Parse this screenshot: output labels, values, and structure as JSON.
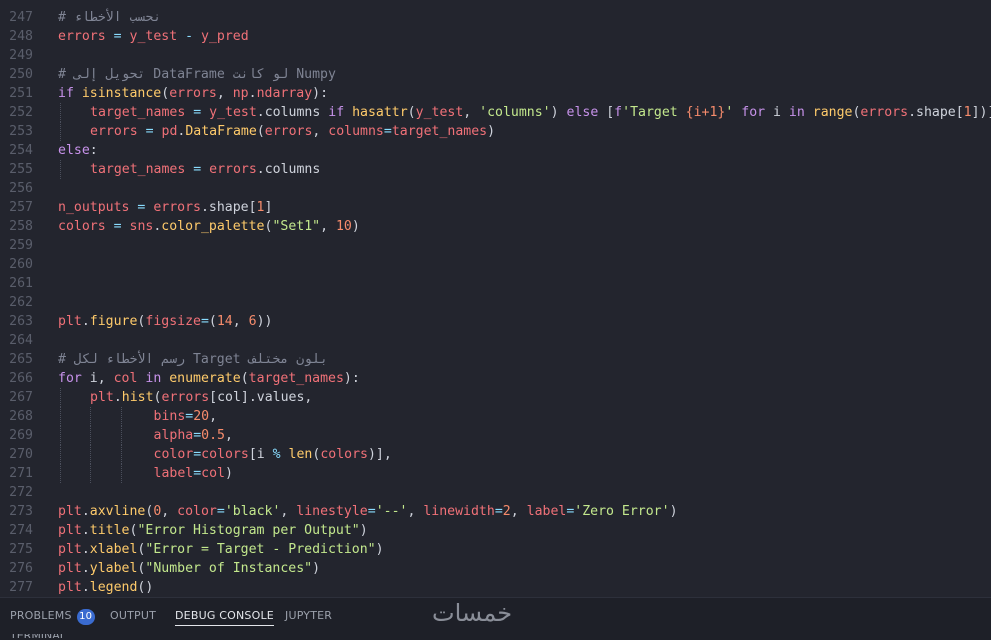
{
  "editor": {
    "lines": [
      {
        "n": "247",
        "indent": [],
        "tokens": [
          {
            "t": "# ",
            "c": "c"
          },
          {
            "t": "نحسب الأخطاء",
            "c": "c"
          }
        ]
      },
      {
        "n": "248",
        "indent": [],
        "tokens": [
          {
            "t": "errors",
            "c": "v"
          },
          {
            "t": " ",
            "c": "p"
          },
          {
            "t": "=",
            "c": "o"
          },
          {
            "t": " ",
            "c": "p"
          },
          {
            "t": "y_test",
            "c": "v"
          },
          {
            "t": " ",
            "c": "p"
          },
          {
            "t": "-",
            "c": "o"
          },
          {
            "t": " ",
            "c": "p"
          },
          {
            "t": "y_pred",
            "c": "v"
          }
        ]
      },
      {
        "n": "249",
        "indent": [],
        "tokens": []
      },
      {
        "n": "250",
        "indent": [],
        "tokens": [
          {
            "t": "# ",
            "c": "c"
          },
          {
            "t": "تحويل إلى DataFrame لو كانت Numpy",
            "c": "c"
          }
        ]
      },
      {
        "n": "251",
        "indent": [],
        "tokens": [
          {
            "t": "if",
            "c": "k"
          },
          {
            "t": " ",
            "c": "p"
          },
          {
            "t": "isinstance",
            "c": "f"
          },
          {
            "t": "(",
            "c": "p"
          },
          {
            "t": "errors",
            "c": "v"
          },
          {
            "t": ", ",
            "c": "p"
          },
          {
            "t": "np",
            "c": "v"
          },
          {
            "t": ".",
            "c": "p"
          },
          {
            "t": "ndarray",
            "c": "v"
          },
          {
            "t": "):",
            "c": "p"
          }
        ]
      },
      {
        "n": "252",
        "indent": [
          1
        ],
        "tokens": [
          {
            "t": "target_names",
            "c": "v"
          },
          {
            "t": " ",
            "c": "p"
          },
          {
            "t": "=",
            "c": "o"
          },
          {
            "t": " ",
            "c": "p"
          },
          {
            "t": "y_test",
            "c": "v"
          },
          {
            "t": ".columns ",
            "c": "p"
          },
          {
            "t": "if",
            "c": "k"
          },
          {
            "t": " ",
            "c": "p"
          },
          {
            "t": "hasattr",
            "c": "f"
          },
          {
            "t": "(",
            "c": "p"
          },
          {
            "t": "y_test",
            "c": "v"
          },
          {
            "t": ", ",
            "c": "p"
          },
          {
            "t": "'columns'",
            "c": "s"
          },
          {
            "t": ") ",
            "c": "p"
          },
          {
            "t": "else",
            "c": "k"
          },
          {
            "t": " [",
            "c": "p"
          },
          {
            "t": "f",
            "c": "k"
          },
          {
            "t": "'Target ",
            "c": "s"
          },
          {
            "t": "{i+1}",
            "c": "n"
          },
          {
            "t": "'",
            "c": "s"
          },
          {
            "t": " ",
            "c": "p"
          },
          {
            "t": "for",
            "c": "k"
          },
          {
            "t": " i ",
            "c": "p"
          },
          {
            "t": "in",
            "c": "k"
          },
          {
            "t": " ",
            "c": "p"
          },
          {
            "t": "range",
            "c": "f"
          },
          {
            "t": "(",
            "c": "p"
          },
          {
            "t": "errors",
            "c": "v"
          },
          {
            "t": ".shape[",
            "c": "p"
          },
          {
            "t": "1",
            "c": "n"
          },
          {
            "t": "])]",
            "c": "p"
          }
        ]
      },
      {
        "n": "253",
        "indent": [
          1
        ],
        "tokens": [
          {
            "t": "errors",
            "c": "v"
          },
          {
            "t": " ",
            "c": "p"
          },
          {
            "t": "=",
            "c": "o"
          },
          {
            "t": " ",
            "c": "p"
          },
          {
            "t": "pd",
            "c": "v"
          },
          {
            "t": ".",
            "c": "p"
          },
          {
            "t": "DataFrame",
            "c": "f"
          },
          {
            "t": "(",
            "c": "p"
          },
          {
            "t": "errors",
            "c": "v"
          },
          {
            "t": ", ",
            "c": "p"
          },
          {
            "t": "columns",
            "c": "v"
          },
          {
            "t": "=",
            "c": "o"
          },
          {
            "t": "target_names",
            "c": "v"
          },
          {
            "t": ")",
            "c": "p"
          }
        ]
      },
      {
        "n": "254",
        "indent": [],
        "tokens": [
          {
            "t": "else",
            "c": "k"
          },
          {
            "t": ":",
            "c": "p"
          }
        ]
      },
      {
        "n": "255",
        "indent": [
          1
        ],
        "tokens": [
          {
            "t": "target_names",
            "c": "v"
          },
          {
            "t": " ",
            "c": "p"
          },
          {
            "t": "=",
            "c": "o"
          },
          {
            "t": " ",
            "c": "p"
          },
          {
            "t": "errors",
            "c": "v"
          },
          {
            "t": ".columns",
            "c": "p"
          }
        ]
      },
      {
        "n": "256",
        "indent": [],
        "tokens": []
      },
      {
        "n": "257",
        "indent": [],
        "tokens": [
          {
            "t": "n_outputs",
            "c": "v"
          },
          {
            "t": " ",
            "c": "p"
          },
          {
            "t": "=",
            "c": "o"
          },
          {
            "t": " ",
            "c": "p"
          },
          {
            "t": "errors",
            "c": "v"
          },
          {
            "t": ".shape[",
            "c": "p"
          },
          {
            "t": "1",
            "c": "n"
          },
          {
            "t": "]",
            "c": "p"
          }
        ]
      },
      {
        "n": "258",
        "indent": [],
        "tokens": [
          {
            "t": "colors",
            "c": "v"
          },
          {
            "t": " ",
            "c": "p"
          },
          {
            "t": "=",
            "c": "o"
          },
          {
            "t": " ",
            "c": "p"
          },
          {
            "t": "sns",
            "c": "v"
          },
          {
            "t": ".",
            "c": "p"
          },
          {
            "t": "color_palette",
            "c": "f"
          },
          {
            "t": "(",
            "c": "p"
          },
          {
            "t": "\"Set1\"",
            "c": "s"
          },
          {
            "t": ", ",
            "c": "p"
          },
          {
            "t": "10",
            "c": "n"
          },
          {
            "t": ")",
            "c": "p"
          }
        ]
      },
      {
        "n": "259",
        "indent": [],
        "tokens": []
      },
      {
        "n": "260",
        "indent": [],
        "tokens": []
      },
      {
        "n": "261",
        "indent": [],
        "tokens": []
      },
      {
        "n": "262",
        "indent": [],
        "tokens": []
      },
      {
        "n": "263",
        "indent": [],
        "tokens": [
          {
            "t": "plt",
            "c": "v"
          },
          {
            "t": ".",
            "c": "p"
          },
          {
            "t": "figure",
            "c": "f"
          },
          {
            "t": "(",
            "c": "p"
          },
          {
            "t": "figsize",
            "c": "v"
          },
          {
            "t": "=",
            "c": "o"
          },
          {
            "t": "(",
            "c": "p"
          },
          {
            "t": "14",
            "c": "n"
          },
          {
            "t": ", ",
            "c": "p"
          },
          {
            "t": "6",
            "c": "n"
          },
          {
            "t": "))",
            "c": "p"
          }
        ]
      },
      {
        "n": "264",
        "indent": [],
        "tokens": []
      },
      {
        "n": "265",
        "indent": [],
        "tokens": [
          {
            "t": "# ",
            "c": "c"
          },
          {
            "t": "رسم الأخطاء لكل Target بلون مختلف",
            "c": "c"
          }
        ]
      },
      {
        "n": "266",
        "indent": [],
        "tokens": [
          {
            "t": "for",
            "c": "k"
          },
          {
            "t": " i, ",
            "c": "p"
          },
          {
            "t": "col",
            "c": "v"
          },
          {
            "t": " ",
            "c": "p"
          },
          {
            "t": "in",
            "c": "k"
          },
          {
            "t": " ",
            "c": "p"
          },
          {
            "t": "enumerate",
            "c": "f"
          },
          {
            "t": "(",
            "c": "p"
          },
          {
            "t": "target_names",
            "c": "v"
          },
          {
            "t": "):",
            "c": "p"
          }
        ]
      },
      {
        "n": "267",
        "indent": [
          1
        ],
        "tokens": [
          {
            "t": "plt",
            "c": "v"
          },
          {
            "t": ".",
            "c": "p"
          },
          {
            "t": "hist",
            "c": "f"
          },
          {
            "t": "(",
            "c": "p"
          },
          {
            "t": "errors",
            "c": "v"
          },
          {
            "t": "[col].values,",
            "c": "p"
          }
        ]
      },
      {
        "n": "268",
        "indent": [
          1,
          2,
          3
        ],
        "tokens": [
          {
            "t": "        bins",
            "c": "v"
          },
          {
            "t": "=",
            "c": "o"
          },
          {
            "t": "20",
            "c": "n"
          },
          {
            "t": ",",
            "c": "p"
          }
        ]
      },
      {
        "n": "269",
        "indent": [
          1,
          2,
          3
        ],
        "tokens": [
          {
            "t": "        alpha",
            "c": "v"
          },
          {
            "t": "=",
            "c": "o"
          },
          {
            "t": "0.5",
            "c": "n"
          },
          {
            "t": ",",
            "c": "p"
          }
        ]
      },
      {
        "n": "270",
        "indent": [
          1,
          2,
          3
        ],
        "tokens": [
          {
            "t": "        color",
            "c": "v"
          },
          {
            "t": "=",
            "c": "o"
          },
          {
            "t": "colors",
            "c": "v"
          },
          {
            "t": "[i ",
            "c": "p"
          },
          {
            "t": "%",
            "c": "o"
          },
          {
            "t": " ",
            "c": "p"
          },
          {
            "t": "len",
            "c": "f"
          },
          {
            "t": "(",
            "c": "p"
          },
          {
            "t": "colors",
            "c": "v"
          },
          {
            "t": ")],",
            "c": "p"
          }
        ]
      },
      {
        "n": "271",
        "indent": [
          1,
          2,
          3
        ],
        "tokens": [
          {
            "t": "        label",
            "c": "v"
          },
          {
            "t": "=",
            "c": "o"
          },
          {
            "t": "col",
            "c": "v"
          },
          {
            "t": ")",
            "c": "p"
          }
        ]
      },
      {
        "n": "272",
        "indent": [],
        "tokens": []
      },
      {
        "n": "273",
        "indent": [],
        "tokens": [
          {
            "t": "plt",
            "c": "v"
          },
          {
            "t": ".",
            "c": "p"
          },
          {
            "t": "axvline",
            "c": "f"
          },
          {
            "t": "(",
            "c": "p"
          },
          {
            "t": "0",
            "c": "n"
          },
          {
            "t": ", ",
            "c": "p"
          },
          {
            "t": "color",
            "c": "v"
          },
          {
            "t": "=",
            "c": "o"
          },
          {
            "t": "'black'",
            "c": "s"
          },
          {
            "t": ", ",
            "c": "p"
          },
          {
            "t": "linestyle",
            "c": "v"
          },
          {
            "t": "=",
            "c": "o"
          },
          {
            "t": "'--'",
            "c": "s"
          },
          {
            "t": ", ",
            "c": "p"
          },
          {
            "t": "linewidth",
            "c": "v"
          },
          {
            "t": "=",
            "c": "o"
          },
          {
            "t": "2",
            "c": "n"
          },
          {
            "t": ", ",
            "c": "p"
          },
          {
            "t": "label",
            "c": "v"
          },
          {
            "t": "=",
            "c": "o"
          },
          {
            "t": "'Zero Error'",
            "c": "s"
          },
          {
            "t": ")",
            "c": "p"
          }
        ]
      },
      {
        "n": "274",
        "indent": [],
        "tokens": [
          {
            "t": "plt",
            "c": "v"
          },
          {
            "t": ".",
            "c": "p"
          },
          {
            "t": "title",
            "c": "f"
          },
          {
            "t": "(",
            "c": "p"
          },
          {
            "t": "\"Error Histogram per Output\"",
            "c": "s"
          },
          {
            "t": ")",
            "c": "p"
          }
        ]
      },
      {
        "n": "275",
        "indent": [],
        "tokens": [
          {
            "t": "plt",
            "c": "v"
          },
          {
            "t": ".",
            "c": "p"
          },
          {
            "t": "xlabel",
            "c": "f"
          },
          {
            "t": "(",
            "c": "p"
          },
          {
            "t": "\"Error = Target - Prediction\"",
            "c": "s"
          },
          {
            "t": ")",
            "c": "p"
          }
        ]
      },
      {
        "n": "276",
        "indent": [],
        "tokens": [
          {
            "t": "plt",
            "c": "v"
          },
          {
            "t": ".",
            "c": "p"
          },
          {
            "t": "ylabel",
            "c": "f"
          },
          {
            "t": "(",
            "c": "p"
          },
          {
            "t": "\"Number of Instances\"",
            "c": "s"
          },
          {
            "t": ")",
            "c": "p"
          }
        ]
      },
      {
        "n": "277",
        "indent": [],
        "tokens": [
          {
            "t": "plt",
            "c": "v"
          },
          {
            "t": ".",
            "c": "p"
          },
          {
            "t": "legend",
            "c": "f"
          },
          {
            "t": "()",
            "c": "p"
          }
        ]
      }
    ]
  },
  "panel": {
    "tabs": [
      {
        "label": "PROBLEMS",
        "badge": "10",
        "active": false
      },
      {
        "label": "OUTPUT",
        "active": false
      },
      {
        "label": "DEBUG CONSOLE",
        "active": true
      },
      {
        "label": "JUPYTER",
        "active": false
      }
    ],
    "watermark": "خمسات",
    "terminal_label": "TERMINAL"
  },
  "colors": {
    "background": "#23252e",
    "panel_background": "#1e2028",
    "badge": "#3a6bd0",
    "comment": "#7f8494",
    "keyword": "#c792ea",
    "variable": "#f07178",
    "function": "#ffcb6b",
    "string": "#c3e88d",
    "number": "#f78c6c"
  }
}
